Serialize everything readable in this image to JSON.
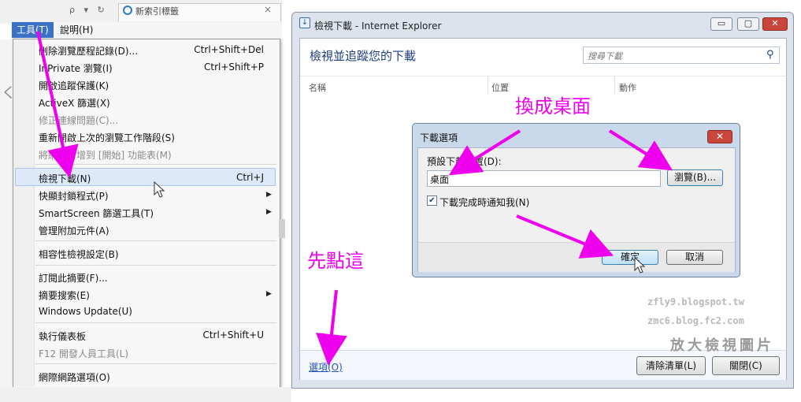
{
  "browser": {
    "tab_title": "新索引標籤",
    "nav_glyphs": "ρ ▾ ↻",
    "tab_close": "×",
    "side_fragment": "く",
    "menubar": {
      "tools": "工具(T)",
      "help": "說明(H)"
    }
  },
  "tools_menu": {
    "items": [
      {
        "label": "刪除瀏覽歷程記錄(D)...",
        "shortcut": "Ctrl+Shift+Del"
      },
      {
        "label": "InPrivate 瀏覽(I)",
        "shortcut": "Ctrl+Shift+P"
      },
      {
        "label": "開啟追蹤保護(K)"
      },
      {
        "label": "ActiveX 篩選(X)"
      },
      {
        "label": "修正連線問題(C)..."
      },
      {
        "label": "重新開啟上次的瀏覽工作階段(S)"
      },
      {
        "label": "將網站新增到 [開始] 功能表(M)"
      },
      {
        "label": "檢視下載(N)",
        "shortcut": "Ctrl+J"
      },
      {
        "label": "快顯封鎖程式(P)"
      },
      {
        "label": "SmartScreen 篩選工具(T)"
      },
      {
        "label": "管理附加元件(A)"
      },
      {
        "label": "相容性檢視設定(B)"
      },
      {
        "label": "訂閱此摘要(F)..."
      },
      {
        "label": "摘要搜索(E)"
      },
      {
        "label": "Windows Update(U)"
      },
      {
        "label": "執行儀表板",
        "shortcut": "Ctrl+Shift+U"
      },
      {
        "label": "F12 開發人員工具(L)"
      },
      {
        "label": "網際網路選項(O)"
      }
    ],
    "submenu_arrow": "▶"
  },
  "download_window": {
    "title": "檢視下載 - Internet Explorer",
    "title_icon": "↓",
    "window_buttons": {
      "minimize": "▭",
      "maximize": "▢",
      "close": "✕"
    },
    "heading": "檢視並追蹤您的下載",
    "search_placeholder": "搜尋下載",
    "search_icon": "⚲",
    "columns": [
      "名稱",
      "位置",
      "動作"
    ],
    "options_link": "選項(O)",
    "clear_list": "清除清單(L)",
    "close": "關閉(C)"
  },
  "options_dialog": {
    "title": "下載選項",
    "close_glyph": "✕",
    "default_location_label": "預設下載位置(D):",
    "location_value": "桌面",
    "browse_button": "瀏覽(B)...",
    "notify_checkbox": {
      "label": "下載完成時通知我(N)",
      "checked": true,
      "glyph": "✔"
    },
    "ok_button": "確定",
    "cancel_button": "取消"
  },
  "annotations": {
    "change_to_desktop": "換成桌面",
    "click_here_first": "先點這"
  },
  "watermark": {
    "line1": "zfly9.blogspot.tw",
    "line2": "zmc6.blog.fc2.com",
    "line3": "放大檢視圖片"
  },
  "colors": {
    "annotation": "#ee00ee",
    "menu_highlight": "#dde8f8",
    "heading_blue": "#1e3d87"
  }
}
